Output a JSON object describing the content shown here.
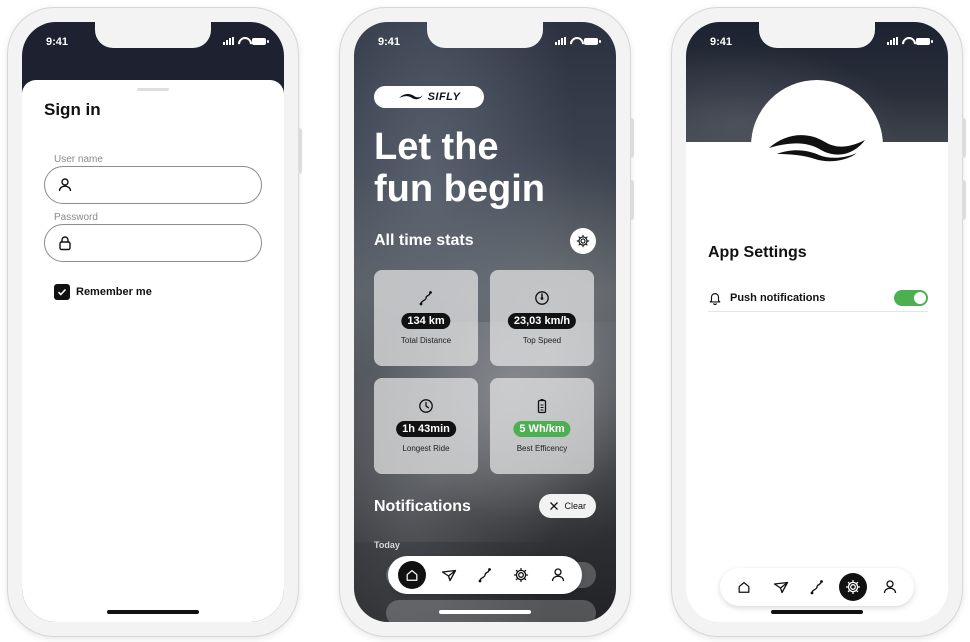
{
  "status_bar": {
    "time": "9:41"
  },
  "signin": {
    "title": "Sign in",
    "username_label": "User name",
    "username_value": "",
    "password_label": "Password",
    "password_value": "",
    "remember_label": "Remember me",
    "remember_checked": true
  },
  "home": {
    "brand": "SIFLY",
    "hero_line1": "Let the",
    "hero_line2": "fun begin",
    "stats_title": "All time stats",
    "stats": [
      {
        "icon": "route-icon",
        "value": "134 km",
        "label": "Total Distance"
      },
      {
        "icon": "speedometer-icon",
        "value": "23,03 km/h",
        "label": "Top Speed"
      },
      {
        "icon": "clock-icon",
        "value": "1h 43min",
        "label": "Longest Ride"
      },
      {
        "icon": "battery-icon",
        "value": "5 Wh/km",
        "label": "Best Efficency"
      }
    ],
    "notifications_title": "Notifications",
    "clear_label": "Clear",
    "today_label": "Today"
  },
  "settings": {
    "title": "App Settings",
    "push_label": "Push notifications",
    "push_enabled": true
  },
  "tabbar": {
    "items": [
      "home-icon",
      "send-icon",
      "route-icon",
      "gear-icon",
      "user-icon"
    ],
    "home_active": "home",
    "settings_active": "settings"
  },
  "colors": {
    "accent_green": "#4caf50",
    "dark": "#111111"
  }
}
